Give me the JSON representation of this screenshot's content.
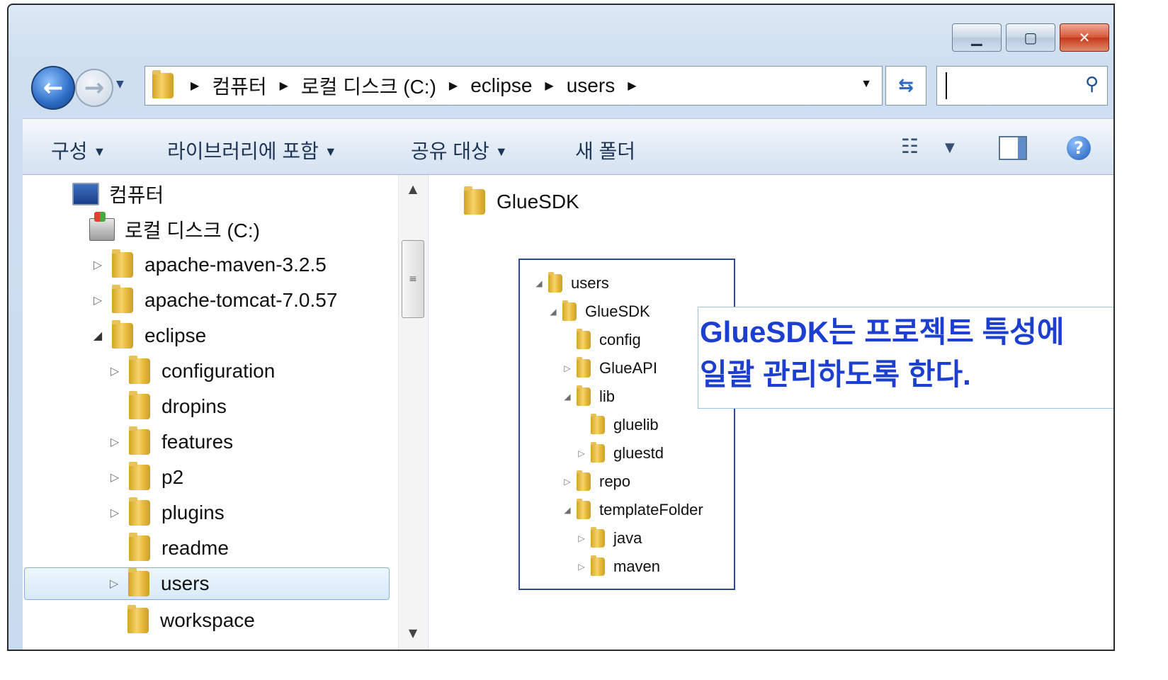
{
  "window": {
    "controls": {
      "minimize": "▁",
      "maximize": "▢",
      "close": "✕"
    }
  },
  "navigation": {
    "breadcrumbs": [
      "컴퓨터",
      "로컬 디스크 (C:)",
      "eclipse",
      "users"
    ],
    "search_placeholder": ""
  },
  "toolbar": {
    "organize": "구성",
    "include_in_library": "라이브러리에 포함",
    "share_with": "공유 대상",
    "new_folder": "새 폴더",
    "help": "?"
  },
  "nav_pane": {
    "computer": "컴퓨터",
    "local_disk": "로컬 디스크 (C:)",
    "items": [
      {
        "label": "apache-maven-3.2.5",
        "expander": "▷"
      },
      {
        "label": "apache-tomcat-7.0.57",
        "expander": "▷"
      },
      {
        "label": "eclipse",
        "expander": "◢"
      },
      {
        "label": "configuration",
        "expander": "▷"
      },
      {
        "label": "dropins",
        "expander": ""
      },
      {
        "label": "features",
        "expander": "▷"
      },
      {
        "label": "p2",
        "expander": "▷"
      },
      {
        "label": "plugins",
        "expander": "▷"
      },
      {
        "label": "readme",
        "expander": ""
      },
      {
        "label": "users",
        "expander": "▷",
        "selected": true
      },
      {
        "label": "workspace",
        "expander": ""
      }
    ]
  },
  "content": {
    "folder": "GlueSDK"
  },
  "inset_tree": [
    {
      "label": "users",
      "expander": "◢"
    },
    {
      "label": "GlueSDK",
      "expander": "◢"
    },
    {
      "label": "config",
      "expander": ""
    },
    {
      "label": "GlueAPI",
      "expander": "▷"
    },
    {
      "label": "lib",
      "expander": "◢"
    },
    {
      "label": "gluelib",
      "expander": ""
    },
    {
      "label": "gluestd",
      "expander": "▷"
    },
    {
      "label": "repo",
      "expander": "▷"
    },
    {
      "label": "templateFolder",
      "expander": "◢"
    },
    {
      "label": "java",
      "expander": "▷"
    },
    {
      "label": "maven",
      "expander": "▷"
    }
  ],
  "callout": {
    "line1": "GlueSDK는 프로젝트 특성에",
    "line2": "일괄 관리하도록 한다."
  },
  "colors": {
    "callout_text": "#1c3fd0",
    "selection_border": "#84acdd"
  }
}
